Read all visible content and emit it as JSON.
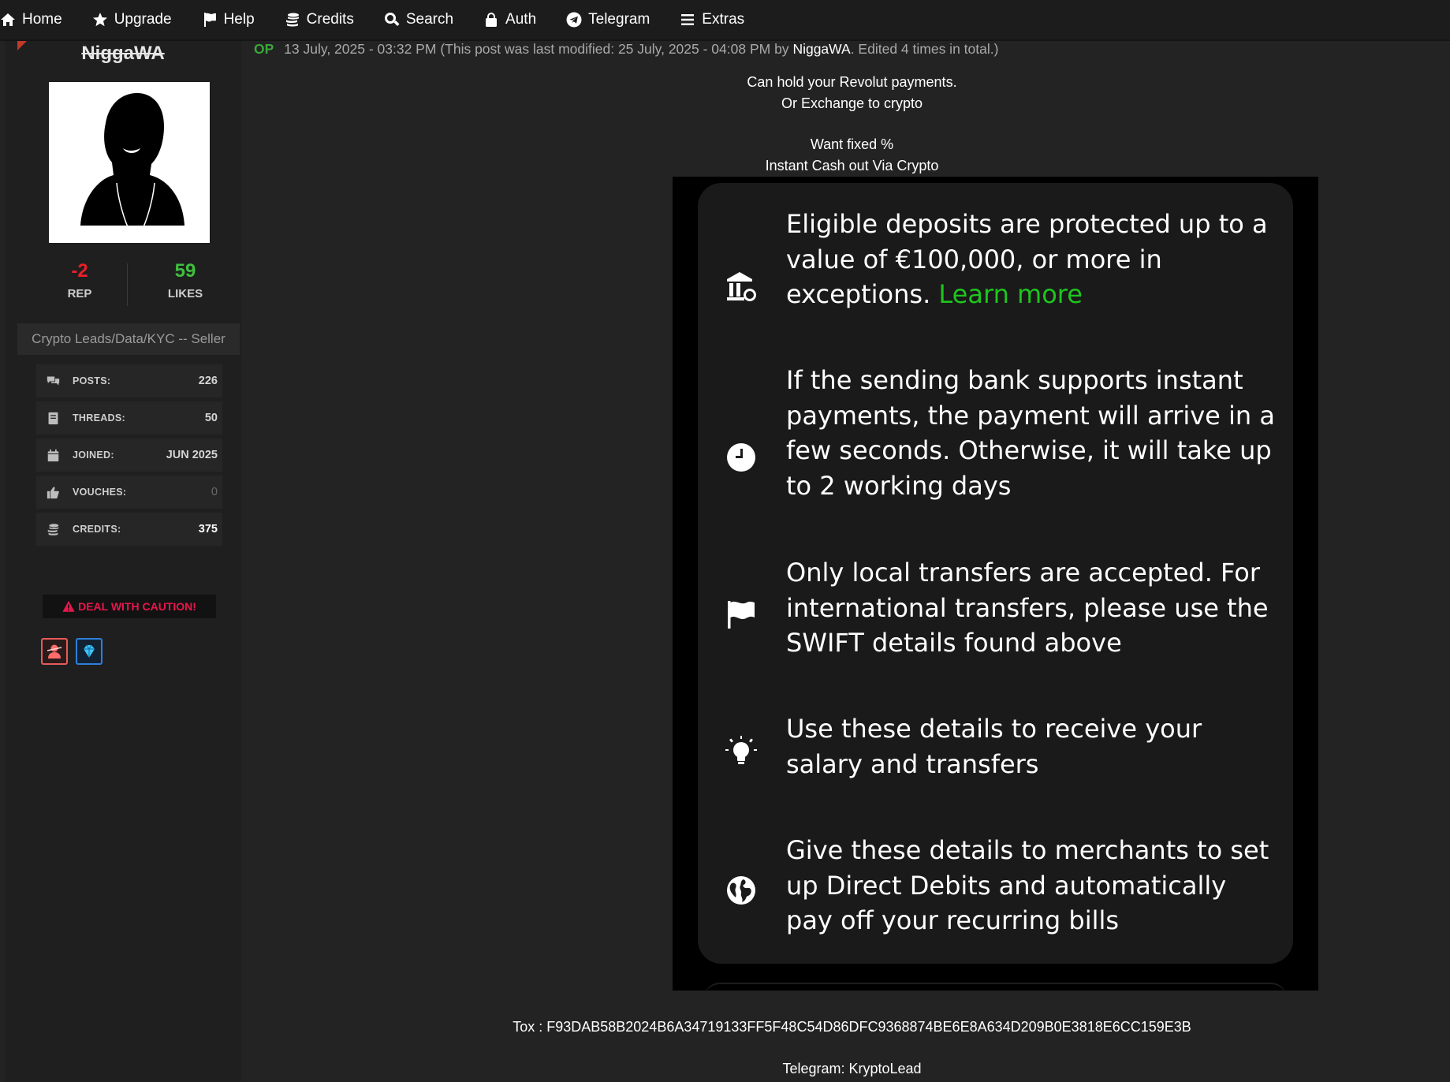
{
  "nav": {
    "items": [
      {
        "label": "Home",
        "icon": "home-icon"
      },
      {
        "label": "Upgrade",
        "icon": "star-icon"
      },
      {
        "label": "Help",
        "icon": "flag-icon"
      },
      {
        "label": "Credits",
        "icon": "coins-icon"
      },
      {
        "label": "Search",
        "icon": "search-icon"
      },
      {
        "label": "Auth",
        "icon": "lock-icon"
      },
      {
        "label": "Telegram",
        "icon": "telegram-icon"
      },
      {
        "label": "Extras",
        "icon": "menu-icon"
      }
    ]
  },
  "user": {
    "name": "NiggaWA",
    "rep_value": "-2",
    "rep_label": "REP",
    "likes_value": "59",
    "likes_label": "LIKES",
    "title": "Crypto Leads/Data/KYC -- Seller",
    "stats": [
      {
        "label": "POSTS:",
        "value": "226",
        "icon": "comments-icon"
      },
      {
        "label": "THREADS:",
        "value": "50",
        "icon": "thread-icon"
      },
      {
        "label": "JOINED:",
        "value": "JUN 2025",
        "icon": "calendar-icon"
      },
      {
        "label": "VOUCHES:",
        "value": "0",
        "icon": "thumbs-up-icon"
      },
      {
        "label": "CREDITS:",
        "value": "375",
        "icon": "coins-icon"
      }
    ],
    "caution": "DEAL WITH CAUTION!",
    "colors": {
      "rep": "#e8202a",
      "likes": "#3fbf3f",
      "caution": "#e8174d"
    }
  },
  "post": {
    "op_badge": "OP",
    "date": "13 July, 2025 - 03:32 PM",
    "modified_prefix": "(This post was last modified: 25 July, 2025 - 04:08 PM by",
    "modified_author": "NiggaWA",
    "modified_suffix": ". Edited 4 times in total.)",
    "lines": [
      "Can hold your Revolut payments.",
      "Or Exchange to crypto",
      "Want fixed %",
      "Instant Cash out Via Crypto"
    ],
    "embedded_items": [
      {
        "icon": "bank-icon",
        "text": "Eligible deposits are protected up to a value of €100,000, or more in exceptions.",
        "link": "Learn more"
      },
      {
        "icon": "clock-icon",
        "text": "If the sending bank supports instant payments, the payment will arrive in a few seconds. Otherwise, it will take up to 2 working days"
      },
      {
        "icon": "flag-icon",
        "text": "Only local transfers are accepted. For international transfers, please use the SWIFT details found above"
      },
      {
        "icon": "lightbulb-icon",
        "text": "Use these details to receive your salary and transfers"
      },
      {
        "icon": "globe-icon",
        "text": "Give these details to merchants to set up Direct Debits and automatically pay off your recurring bills"
      }
    ],
    "tox": "Tox : F93DAB58B2024B6A34719133FF5F48C54D86DFC9368874BE6E8A634D209B0E3818E6CC159E3B",
    "telegram": "Telegram: KryptoLead"
  }
}
